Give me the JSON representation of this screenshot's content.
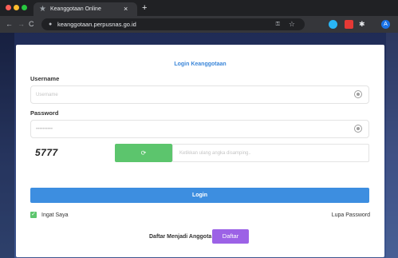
{
  "browser": {
    "tab_title": "Keanggotaan Online",
    "tab_close": "×",
    "new_tab": "+",
    "url": "keanggotaan.perpusnas.go.id",
    "back_glyph": "←",
    "forward_glyph": "→",
    "reload_glyph": "C",
    "lock_glyph": "🔒",
    "key_glyph": "⚿",
    "star_glyph": "☆",
    "extensions": [
      {
        "name": "blue-circle-extension",
        "color": "#29b6f6"
      },
      {
        "name": "red-extension",
        "color": "#e53935"
      },
      {
        "name": "puzzle-extension",
        "glyph": "✱"
      },
      {
        "name": "profile-avatar",
        "letter": "A",
        "color": "#1a73e8"
      }
    ]
  },
  "login": {
    "title": "Login Keanggotaan",
    "username_label": "Username",
    "username_placeholder": "Username",
    "password_label": "Password",
    "password_value": "••••••••••",
    "captcha_code": "5777",
    "captcha_refresh_glyph": "⟳",
    "captcha_placeholder": "Ketikkan ulang angka disamping..",
    "login_button": "Login",
    "remember_label": "Ingat Saya",
    "remember_checked": true,
    "checkmark": "✓",
    "forgot_password": "Lupa Password",
    "register_text": "Daftar Menjadi Anggota",
    "register_button": "Daftar"
  },
  "colors": {
    "accent_blue": "#3d8ee0",
    "green": "#5cc56d",
    "purple": "#9c62e6",
    "background": "#2b3a67"
  }
}
